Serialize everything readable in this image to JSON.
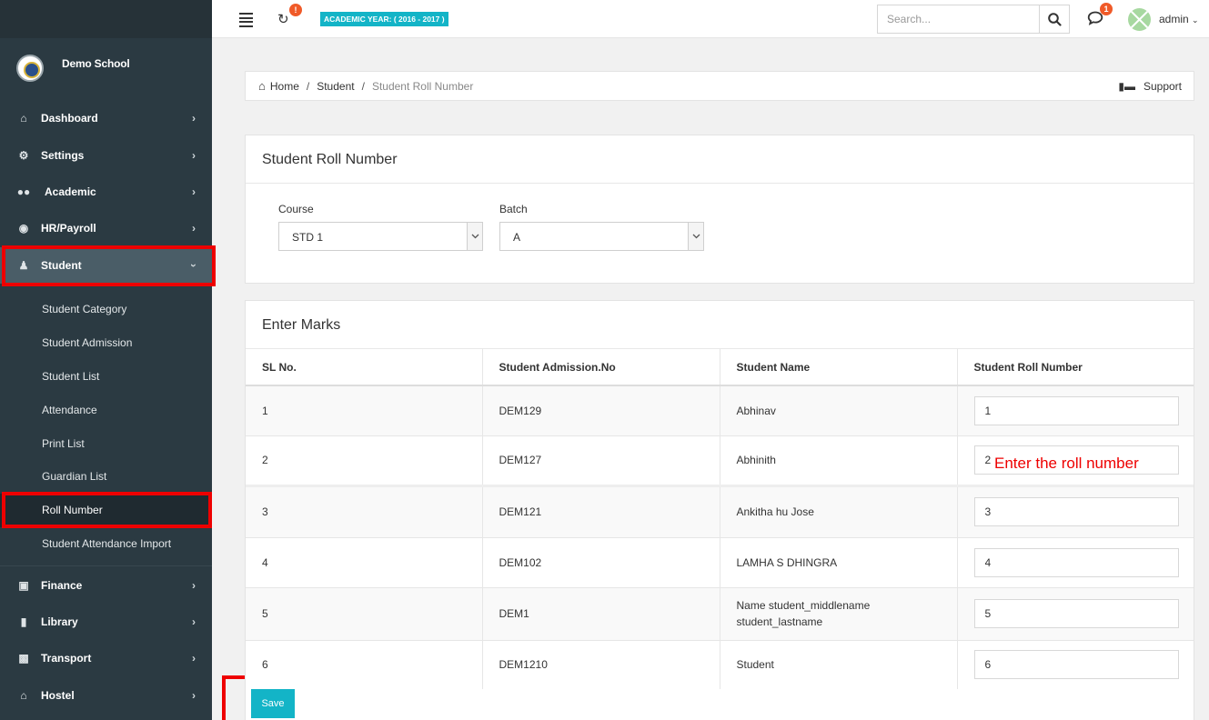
{
  "brand": {
    "name": "Demo School"
  },
  "nav_top": [
    {
      "label": "Dashboard",
      "icon": "home-icon"
    },
    {
      "label": "Settings",
      "icon": "gears-icon"
    },
    {
      "label": "Academic",
      "icon": "users-icon"
    },
    {
      "label": "HR/Payroll",
      "icon": "eye-icon"
    },
    {
      "label": "Student",
      "icon": "user-icon"
    }
  ],
  "student_sub": [
    "Student Category",
    "Student Admission",
    "Student List",
    "Attendance",
    "Print List",
    "Guardian List",
    "Roll Number",
    "Student Attendance Import"
  ],
  "nav_bottom": [
    {
      "label": "Finance",
      "icon": "money-icon"
    },
    {
      "label": "Library",
      "icon": "book-icon"
    },
    {
      "label": "Transport",
      "icon": "truck-icon"
    },
    {
      "label": "Hostel",
      "icon": "home-icon"
    }
  ],
  "topbar": {
    "sync_badge": "!",
    "academic_year": "ACADEMIC YEAR: ( 2016 - 2017 )",
    "search_placeholder": "Search...",
    "chat_badge": "1",
    "user": "admin"
  },
  "breadcrumb": {
    "home": "Home",
    "section": "Student",
    "current": "Student Roll Number",
    "support": "Support"
  },
  "filter_panel": {
    "title": "Student Roll Number",
    "course_label": "Course",
    "course_value": "STD 1",
    "batch_label": "Batch",
    "batch_value": "A"
  },
  "marks_panel": {
    "title": "Enter Marks",
    "columns": [
      "SL No.",
      "Student Admission.No",
      "Student Name",
      "Student Roll Number"
    ],
    "rows": [
      {
        "sl": "1",
        "adm": "DEM129",
        "name": "Abhinav",
        "roll": "1"
      },
      {
        "sl": "2",
        "adm": "DEM127",
        "name": "Abhinith",
        "roll": "2"
      },
      {
        "sl": "3",
        "adm": "DEM121",
        "name": "Ankitha hu Jose",
        "roll": "3"
      },
      {
        "sl": "4",
        "adm": "DEM102",
        "name": "LAMHA S DHINGRA",
        "roll": "4"
      },
      {
        "sl": "5",
        "adm": "DEM1",
        "name": "Name student_middlename student_lastname",
        "roll": "5"
      },
      {
        "sl": "6",
        "adm": "DEM1210",
        "name": "Student",
        "roll": "6"
      }
    ]
  },
  "annotation": "Enter the roll number",
  "save_label": "Save"
}
